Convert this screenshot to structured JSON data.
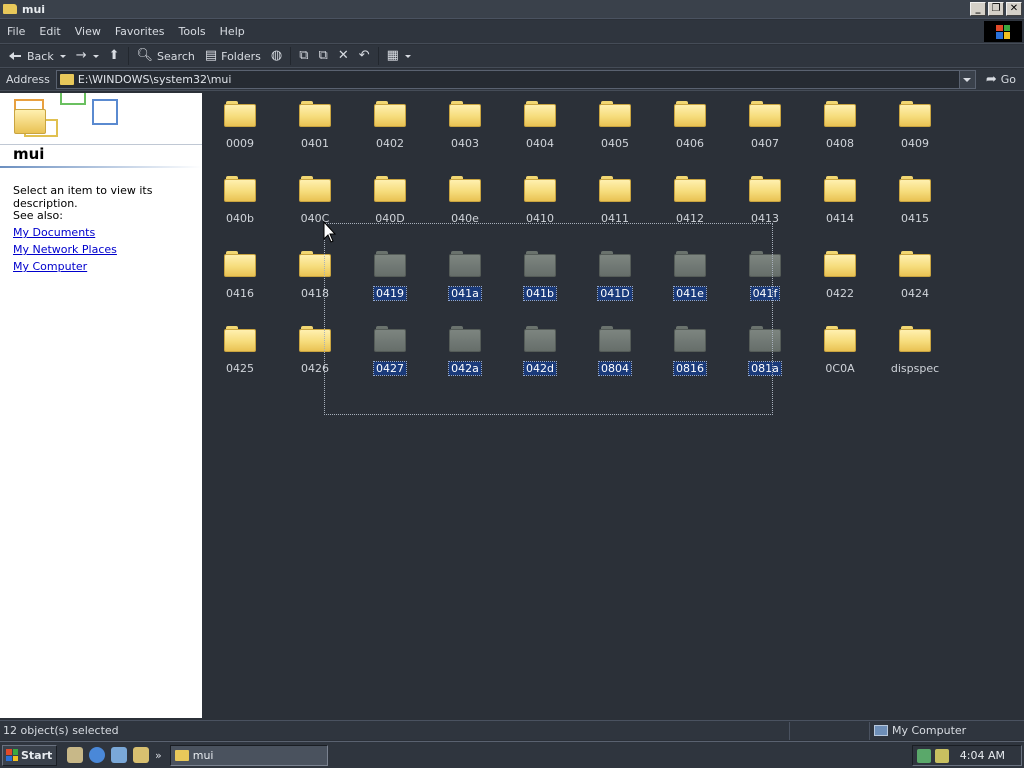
{
  "window": {
    "title": "mui"
  },
  "menu": [
    "File",
    "Edit",
    "View",
    "Favorites",
    "Tools",
    "Help"
  ],
  "toolbar": {
    "back": "Back",
    "search": "Search",
    "folders": "Folders"
  },
  "address": {
    "label": "Address",
    "path": "E:\\WINDOWS\\system32\\mui",
    "go": "Go"
  },
  "leftpane": {
    "title": "mui",
    "description": "Select an item to view its description.",
    "see_also": "See also:",
    "links": [
      "My Documents",
      "My Network Places",
      "My Computer"
    ]
  },
  "folders": [
    {
      "name": "0009",
      "selected": false
    },
    {
      "name": "0401",
      "selected": false
    },
    {
      "name": "0402",
      "selected": false
    },
    {
      "name": "0403",
      "selected": false
    },
    {
      "name": "0404",
      "selected": false
    },
    {
      "name": "0405",
      "selected": false
    },
    {
      "name": "0406",
      "selected": false
    },
    {
      "name": "0407",
      "selected": false
    },
    {
      "name": "0408",
      "selected": false
    },
    {
      "name": "0409",
      "selected": false
    },
    {
      "name": "040b",
      "selected": false
    },
    {
      "name": "040C",
      "selected": false
    },
    {
      "name": "040D",
      "selected": false
    },
    {
      "name": "040e",
      "selected": false
    },
    {
      "name": "0410",
      "selected": false
    },
    {
      "name": "0411",
      "selected": false
    },
    {
      "name": "0412",
      "selected": false
    },
    {
      "name": "0413",
      "selected": false
    },
    {
      "name": "0414",
      "selected": false
    },
    {
      "name": "0415",
      "selected": false
    },
    {
      "name": "0416",
      "selected": false
    },
    {
      "name": "0418",
      "selected": false
    },
    {
      "name": "0419",
      "selected": true
    },
    {
      "name": "041a",
      "selected": true
    },
    {
      "name": "041b",
      "selected": true
    },
    {
      "name": "041D",
      "selected": true
    },
    {
      "name": "041e",
      "selected": true
    },
    {
      "name": "041f",
      "selected": true
    },
    {
      "name": "0422",
      "selected": false
    },
    {
      "name": "0424",
      "selected": false
    },
    {
      "name": "0425",
      "selected": false
    },
    {
      "name": "0426",
      "selected": false
    },
    {
      "name": "0427",
      "selected": true
    },
    {
      "name": "042a",
      "selected": true
    },
    {
      "name": "042d",
      "selected": true
    },
    {
      "name": "0804",
      "selected": true
    },
    {
      "name": "0816",
      "selected": true
    },
    {
      "name": "081a",
      "selected": true
    },
    {
      "name": "0C0A",
      "selected": false
    },
    {
      "name": "dispspec",
      "selected": false
    }
  ],
  "status": {
    "left": "12 object(s) selected",
    "right": "My Computer"
  },
  "taskbar": {
    "start": "Start",
    "task": "mui",
    "clock": "4:04 AM",
    "more": "»"
  },
  "colors": {
    "selection": "#1a3a7a",
    "folder": "#f6dc7c",
    "background": "#2b3038"
  }
}
